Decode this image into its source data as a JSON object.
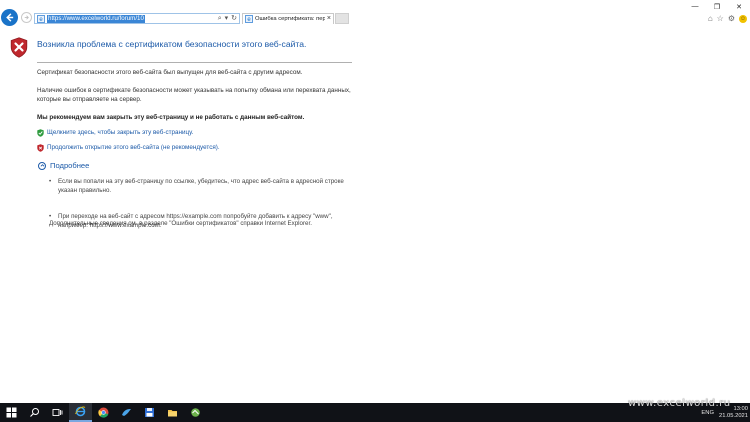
{
  "browser": {
    "address_url": "https://www.excelworld.ru/forum/10",
    "tab_title": "Ошибка сертификата: пер...",
    "tab_close": "×",
    "icons": {
      "back": "back-arrow-icon",
      "forward": "forward-arrow-icon",
      "search": "search-icon",
      "refresh": "refresh-icon",
      "home": "home-icon",
      "favorites": "star-icon",
      "settings": "gear-icon",
      "feedback": "smiley-icon"
    },
    "window_controls": {
      "minimize": "—",
      "restore": "❐",
      "close": "✕"
    }
  },
  "error_page": {
    "title": "Возникла проблема с сертификатом безопасности этого веб-сайта.",
    "paragraph_1": "Сертификат безопасности этого веб-сайта был выпущен для веб-сайта с другим адресом.",
    "paragraph_2": "Наличие ошибок в сертификате безопасности может указывать на попытку обмана или перехвата данных, которые вы отправляете на сервер.",
    "recommendation": "Мы рекомендуем вам закрыть эту веб-страницу и не работать с данным веб-сайтом.",
    "close_link": "Щелкните здесь, чтобы закрыть эту веб-страницу.",
    "continue_link": "Продолжить открытие этого веб-сайта (не рекомендуется).",
    "more_info": "Подробнее",
    "details": [
      "Если вы попали на эту веб-страницу по ссылке, убедитесь, что адрес веб-сайта в адресной строке указан правильно.",
      "При переходе на веб-сайт с адресом https://example.com попробуйте добавить к адресу \"www\", например: https://www.example.com."
    ],
    "footer_note": "Дополнительные сведения см. в разделе \"Ошибки сертификатов\" справки Internet Explorer."
  },
  "taskbar": {
    "items": [
      "start-icon",
      "search-icon",
      "task-view-icon",
      "internet-explorer-icon",
      "chrome-icon",
      "app-icon",
      "save-icon",
      "folder-icon",
      "app-icon-2"
    ],
    "language": "ENG",
    "time": "13:00",
    "date": "21.05.2021"
  },
  "watermark": "www.excelworld.ru",
  "colors": {
    "link": "#1c5aa8",
    "back_button": "#1a73c8",
    "taskbar": "#101217",
    "shield_red": "#c0272d"
  }
}
